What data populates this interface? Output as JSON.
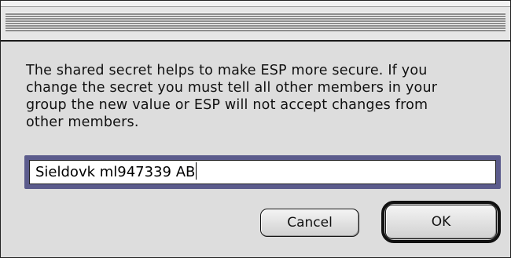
{
  "dialog": {
    "message": "The shared secret helps to make ESP more secure.  If you\nchange the secret you must tell all other members in your\ngroup the new value or ESP will not accept changes from\nother members.",
    "secret_field": {
      "value": "Sieldovk ml947339 AB"
    },
    "buttons": {
      "cancel_label": "Cancel",
      "ok_label": "OK"
    }
  }
}
